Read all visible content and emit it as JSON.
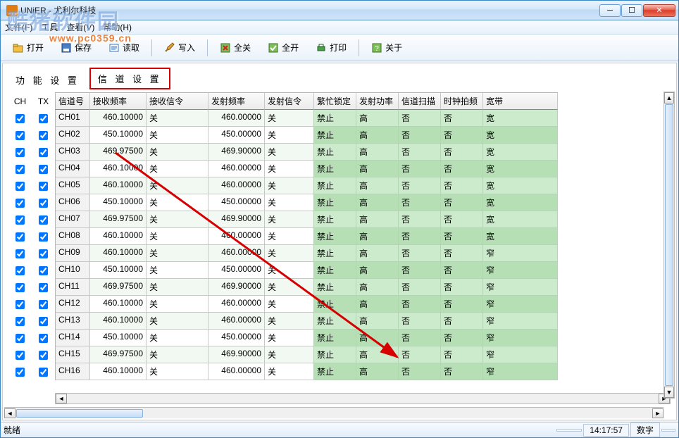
{
  "window": {
    "title": "UNiER - 尤利尔科技"
  },
  "watermark": {
    "text": "酷猪软件园",
    "url": "www.pc0359.cn"
  },
  "menu": {
    "file": "文件(F)",
    "tools": "工具",
    "view": "查看(V)",
    "help": "帮助(H)"
  },
  "toolbar": {
    "open": "打开",
    "save": "保存",
    "read": "读取",
    "write": "写入",
    "all_off": "全关",
    "all_on": "全开",
    "print": "打印",
    "about": "关于"
  },
  "tabs": {
    "func_settings": "功 能 设 置",
    "channel_settings": "信 道 设 置"
  },
  "side_header": {
    "ch": "CH",
    "tx": "TX"
  },
  "columns": {
    "chno": "信道号",
    "rxfreq": "接收频率",
    "rxsig": "接收信令",
    "txfreq": "发射频率",
    "txsig": "发射信令",
    "busy": "繁忙锁定",
    "power": "发射功率",
    "scan": "信道扫描",
    "clock": "时钟拍频",
    "band": "宽带"
  },
  "rows": [
    {
      "ch": "CH01",
      "rxf": "460.10000",
      "rxs": "关",
      "txf": "460.00000",
      "txs": "关",
      "busy": "禁止",
      "pow": "高",
      "scan": "否",
      "clk": "否",
      "band": "宽"
    },
    {
      "ch": "CH02",
      "rxf": "450.10000",
      "rxs": "关",
      "txf": "450.00000",
      "txs": "关",
      "busy": "禁止",
      "pow": "高",
      "scan": "否",
      "clk": "否",
      "band": "宽"
    },
    {
      "ch": "CH03",
      "rxf": "469.97500",
      "rxs": "关",
      "txf": "469.90000",
      "txs": "关",
      "busy": "禁止",
      "pow": "高",
      "scan": "否",
      "clk": "否",
      "band": "宽"
    },
    {
      "ch": "CH04",
      "rxf": "460.10000",
      "rxs": "关",
      "txf": "460.00000",
      "txs": "关",
      "busy": "禁止",
      "pow": "高",
      "scan": "否",
      "clk": "否",
      "band": "宽"
    },
    {
      "ch": "CH05",
      "rxf": "460.10000",
      "rxs": "关",
      "txf": "460.00000",
      "txs": "关",
      "busy": "禁止",
      "pow": "高",
      "scan": "否",
      "clk": "否",
      "band": "宽"
    },
    {
      "ch": "CH06",
      "rxf": "450.10000",
      "rxs": "关",
      "txf": "450.00000",
      "txs": "关",
      "busy": "禁止",
      "pow": "高",
      "scan": "否",
      "clk": "否",
      "band": "宽"
    },
    {
      "ch": "CH07",
      "rxf": "469.97500",
      "rxs": "关",
      "txf": "469.90000",
      "txs": "关",
      "busy": "禁止",
      "pow": "高",
      "scan": "否",
      "clk": "否",
      "band": "宽"
    },
    {
      "ch": "CH08",
      "rxf": "460.10000",
      "rxs": "关",
      "txf": "460.00000",
      "txs": "关",
      "busy": "禁止",
      "pow": "高",
      "scan": "否",
      "clk": "否",
      "band": "宽"
    },
    {
      "ch": "CH09",
      "rxf": "460.10000",
      "rxs": "关",
      "txf": "460.00000",
      "txs": "关",
      "busy": "禁止",
      "pow": "高",
      "scan": "否",
      "clk": "否",
      "band": "窄"
    },
    {
      "ch": "CH10",
      "rxf": "450.10000",
      "rxs": "关",
      "txf": "450.00000",
      "txs": "关",
      "busy": "禁止",
      "pow": "高",
      "scan": "否",
      "clk": "否",
      "band": "窄"
    },
    {
      "ch": "CH11",
      "rxf": "469.97500",
      "rxs": "关",
      "txf": "469.90000",
      "txs": "关",
      "busy": "禁止",
      "pow": "高",
      "scan": "否",
      "clk": "否",
      "band": "窄"
    },
    {
      "ch": "CH12",
      "rxf": "460.10000",
      "rxs": "关",
      "txf": "460.00000",
      "txs": "关",
      "busy": "禁止",
      "pow": "高",
      "scan": "否",
      "clk": "否",
      "band": "窄"
    },
    {
      "ch": "CH13",
      "rxf": "460.10000",
      "rxs": "关",
      "txf": "460.00000",
      "txs": "关",
      "busy": "禁止",
      "pow": "高",
      "scan": "否",
      "clk": "否",
      "band": "窄"
    },
    {
      "ch": "CH14",
      "rxf": "450.10000",
      "rxs": "关",
      "txf": "450.00000",
      "txs": "关",
      "busy": "禁止",
      "pow": "高",
      "scan": "否",
      "clk": "否",
      "band": "窄"
    },
    {
      "ch": "CH15",
      "rxf": "469.97500",
      "rxs": "关",
      "txf": "469.90000",
      "txs": "关",
      "busy": "禁止",
      "pow": "高",
      "scan": "否",
      "clk": "否",
      "band": "窄"
    },
    {
      "ch": "CH16",
      "rxf": "460.10000",
      "rxs": "关",
      "txf": "460.00000",
      "txs": "关",
      "busy": "禁止",
      "pow": "高",
      "scan": "否",
      "clk": "否",
      "band": "窄"
    }
  ],
  "status": {
    "ready": "就绪",
    "time": "14:17:57",
    "num": "数字"
  }
}
